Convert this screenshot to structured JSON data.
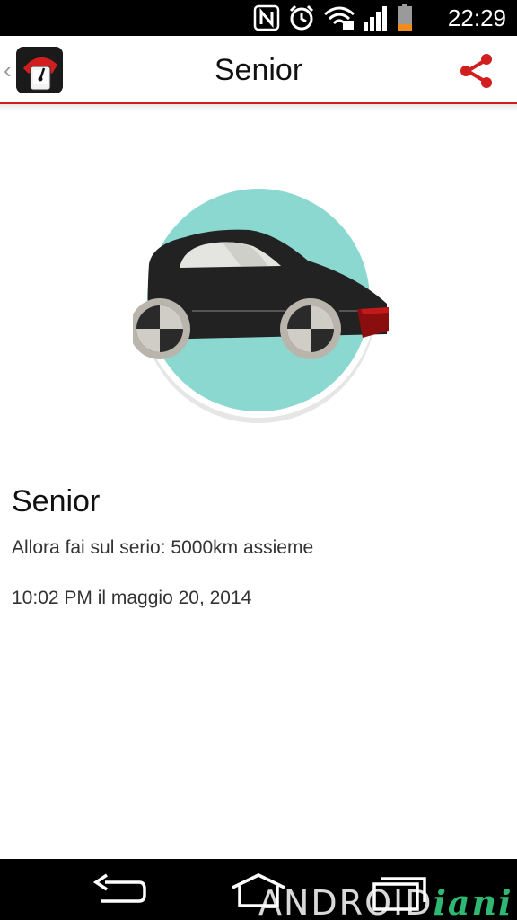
{
  "status_bar": {
    "time": "22:29",
    "icons": [
      "nfc-icon",
      "alarm-icon",
      "wifi-icon",
      "signal-icon",
      "battery-icon"
    ]
  },
  "action_bar": {
    "title": "Senior",
    "up_icon": "chevron-left-icon",
    "app_icon": "speedometer-app-icon",
    "share_icon": "share-icon"
  },
  "badge": {
    "illustration": "car-badge",
    "title": "Senior",
    "description": "Allora fai sul serio: 5000km assieme",
    "date": "10:02 PM il maggio 20, 2014"
  },
  "nav_bar": {
    "buttons": [
      "back-icon",
      "home-icon",
      "recents-icon"
    ]
  },
  "watermark": {
    "part1": "ANDROID",
    "part2": "iani"
  },
  "colors": {
    "accent": "#d11f1f",
    "badge_circle": "#8ad8d0",
    "car_body": "#222222",
    "status_bar": "#000000",
    "nav_bar": "#000000"
  }
}
